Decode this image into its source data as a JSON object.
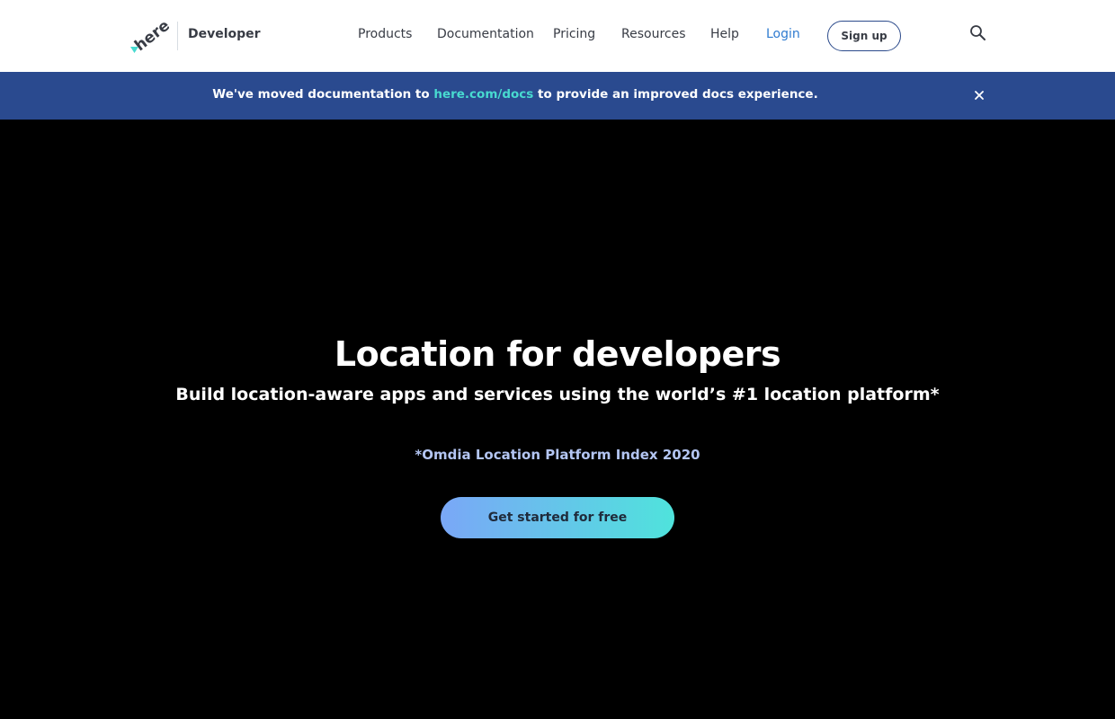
{
  "header": {
    "brand": "Developer",
    "nav": {
      "products": "Products",
      "documentation": "Documentation",
      "pricing": "Pricing",
      "resources": "Resources",
      "help": "Help",
      "login": "Login"
    },
    "signup_label": "Sign up",
    "icons": {
      "search": "search-icon",
      "logo": "here-logo"
    }
  },
  "banner": {
    "text_before": "We've moved documentation to ",
    "link_text": "here.com/docs",
    "text_after": " to provide an improved docs experience.",
    "close_icon": "close-icon"
  },
  "hero": {
    "title": "Location for developers",
    "subtitle": "Build location-aware apps and services using the world’s #1 location platform*",
    "note": "*Omdia Location Platform Index 2020",
    "cta_label": "Get started for free"
  },
  "colors": {
    "banner_bg": "#2a4a8f",
    "link_accent": "#48dad0",
    "login_blue": "#2f7bd0",
    "hero_bg": "#000000",
    "cta_gradient_start": "#7aa7f7",
    "cta_gradient_end": "#4fe3dc"
  }
}
